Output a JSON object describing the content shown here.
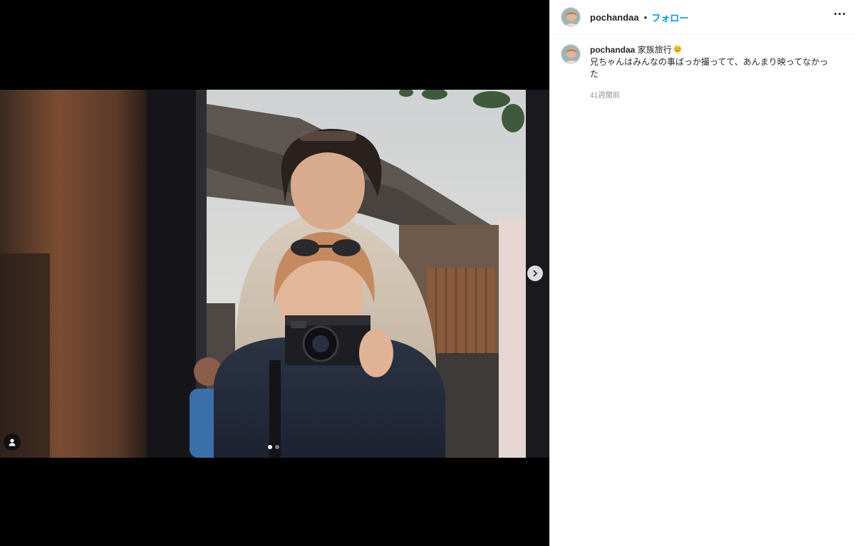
{
  "post": {
    "username": "pochandaa",
    "separator": "•",
    "follow_label": "フォロー",
    "more_icon": "more-horizontal-icon"
  },
  "media": {
    "carousel_count": 2,
    "active_index": 0,
    "next_icon": "chevron-right-icon",
    "tag_icon": "user-tag-icon"
  },
  "caption": {
    "username": "pochandaa",
    "title": "家族旅行",
    "emoji": "smiling-face-icon",
    "text": "兄ちゃんはみんなの事ばっか撮ってて、あんまり映ってなかった",
    "timestamp": "41週間前"
  },
  "colors": {
    "follow_blue": "#0095f6",
    "text_primary": "#262626",
    "text_secondary": "#8e8e8e"
  }
}
